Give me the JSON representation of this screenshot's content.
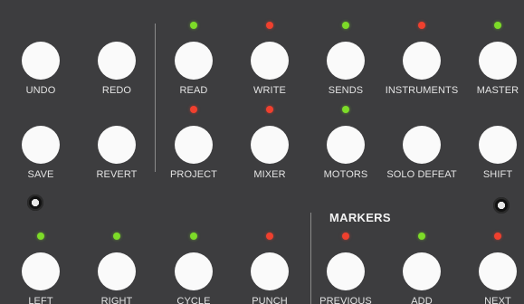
{
  "buttons": {
    "undo": {
      "label": "UNDO"
    },
    "redo": {
      "label": "REDO"
    },
    "read": {
      "label": "READ",
      "led": "green"
    },
    "write": {
      "label": "WRITE",
      "led": "red"
    },
    "sends": {
      "label": "SENDS",
      "led": "green"
    },
    "instruments": {
      "label": "INSTRUMENTS",
      "led": "red"
    },
    "master": {
      "label": "MASTER",
      "led": "green"
    },
    "save": {
      "label": "SAVE"
    },
    "revert": {
      "label": "REVERT"
    },
    "project": {
      "label": "PROJECT",
      "led": "red"
    },
    "mixer": {
      "label": "MIXER",
      "led": "red"
    },
    "motors": {
      "label": "MOTORS",
      "led": "green"
    },
    "solo_defeat": {
      "label": "SOLO DEFEAT"
    },
    "shift": {
      "label": "SHIFT"
    },
    "left": {
      "label": "LEFT",
      "led": "green"
    },
    "right": {
      "label": "RIGHT",
      "led": "green"
    },
    "cycle": {
      "label": "CYCLE",
      "led": "green"
    },
    "punch": {
      "label": "PUNCH",
      "led": "red"
    },
    "previous": {
      "label": "PREVIOUS",
      "led": "red"
    },
    "add": {
      "label": "ADD",
      "led": "green"
    },
    "next": {
      "label": "NEXT",
      "led": "red"
    }
  },
  "markers_title": "MARKERS",
  "colors": {
    "panel": "#3d3d3f",
    "button": "#fafafa",
    "led_green": "#7ddc28",
    "led_red": "#f0402e",
    "label": "#e4e4e4"
  }
}
